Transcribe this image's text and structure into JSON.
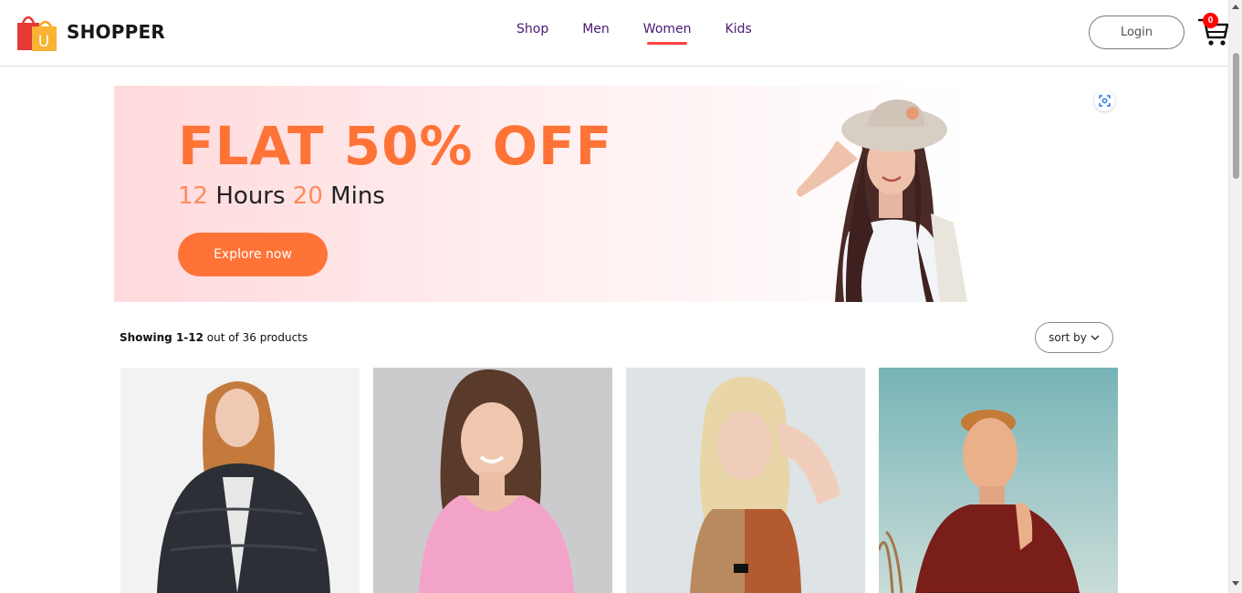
{
  "brand": {
    "name": "SHOPPER",
    "logo_letter": "U"
  },
  "nav": {
    "items": [
      {
        "label": "Shop"
      },
      {
        "label": "Men"
      },
      {
        "label": "Women",
        "active": true
      },
      {
        "label": "Kids"
      }
    ],
    "login_label": "Login",
    "cart_count": "0"
  },
  "hero": {
    "title": "FLAT 50% OFF",
    "timer_hours": "12",
    "timer_hours_unit": "Hours",
    "timer_mins": "20",
    "timer_mins_unit": "Mins",
    "cta_label": "Explore now"
  },
  "products_toolbar": {
    "showing_bold": "Showing 1-12",
    "showing_rest": "out of 36 products",
    "sort_label": "sort by"
  },
  "colors": {
    "accent": "#ff7337",
    "nav_text": "#4b1773",
    "active_underline": "#ff4141",
    "cart_badge": "#ff0000"
  },
  "icons": {
    "logo": "shopping-bag-icon",
    "cart": "cart-icon",
    "visual_search": "visual-search-icon",
    "sort": "chevron-down-icon"
  }
}
